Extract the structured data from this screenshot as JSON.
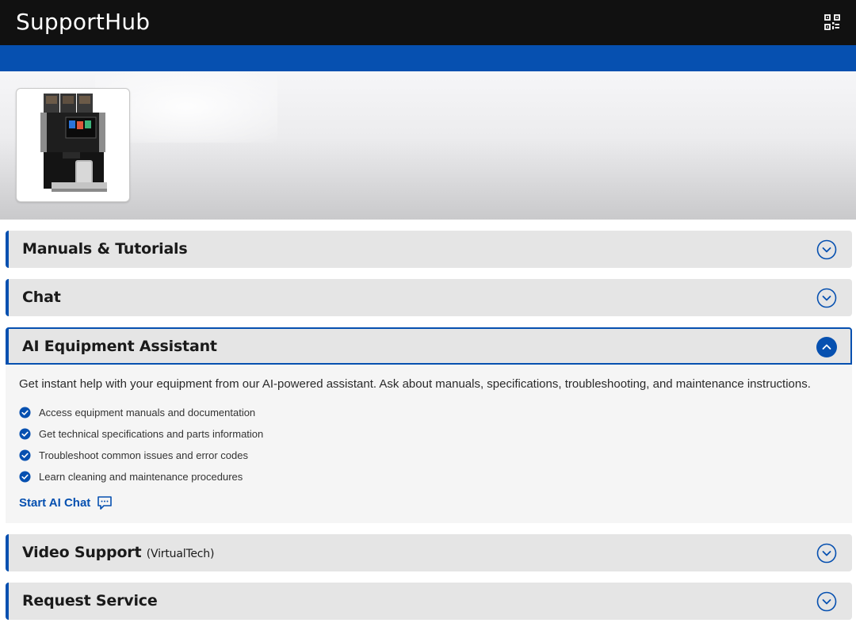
{
  "header": {
    "title": "SupportHub",
    "qr_icon": "qr-code-icon"
  },
  "colors": {
    "accent": "#0650b0",
    "header_bg": "#111111",
    "section_bg": "#e5e5e5"
  },
  "product": {
    "image_icon": "coffee-machine-image"
  },
  "sections": {
    "manuals": {
      "title": "Manuals & Tutorials",
      "icon": "chevron-down-icon"
    },
    "chat": {
      "title": "Chat",
      "icon": "chevron-down-icon"
    },
    "ai": {
      "title": "AI Equipment Assistant",
      "icon": "chevron-up-icon",
      "description": "Get instant help with your equipment from our AI-powered assistant. Ask about manuals, specifications, troubleshooting, and maintenance instructions.",
      "features": [
        "Access equipment manuals and documentation",
        "Get technical specifications and parts information",
        "Troubleshoot common issues and error codes",
        "Learn cleaning and maintenance procedures"
      ],
      "cta_label": "Start AI Chat",
      "cta_icon": "chat-bubble-icon"
    },
    "video": {
      "title": "Video Support",
      "subtitle": "(VirtualTech)",
      "icon": "chevron-down-icon"
    },
    "service": {
      "title": "Request Service",
      "icon": "chevron-down-icon"
    }
  }
}
